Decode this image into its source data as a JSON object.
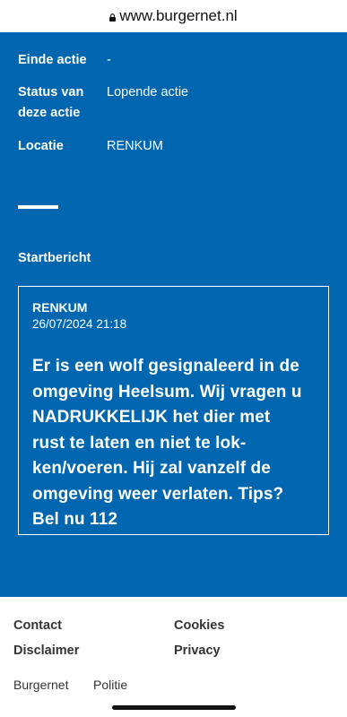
{
  "browser": {
    "url": "www.burgernet.nl",
    "lock_icon": "lock-icon"
  },
  "details": {
    "end_label": "Einde actie",
    "end_value": "-",
    "status_label_line1": "Status van",
    "status_label_line2": "deze actie",
    "status_value": "Lopende actie",
    "location_label": "Locatie",
    "location_value": "RENKUM"
  },
  "start_message": {
    "section_title": "Startbericht",
    "place": "RENKUM",
    "datetime": "26/07/2024 21:18",
    "body_lines": [
      "Er is een wolf gesignaleerd in de",
      "omgeving Heelsum. Wij vragen u",
      "NADRUKKELIJK het dier met",
      "rust te laten en niet te lok-",
      "ken/voeren. Hij zal vanzelf de",
      "omgeving weer verlaten. Tips?",
      "Bel nu 112"
    ]
  },
  "footer": {
    "contact": "Contact",
    "cookies": "Cookies",
    "disclaimer": "Disclaimer",
    "privacy": "Privacy",
    "burgernet": "Burgernet",
    "politie": "Politie"
  },
  "colors": {
    "brand_blue": "#0066b0",
    "white": "#ffffff"
  }
}
